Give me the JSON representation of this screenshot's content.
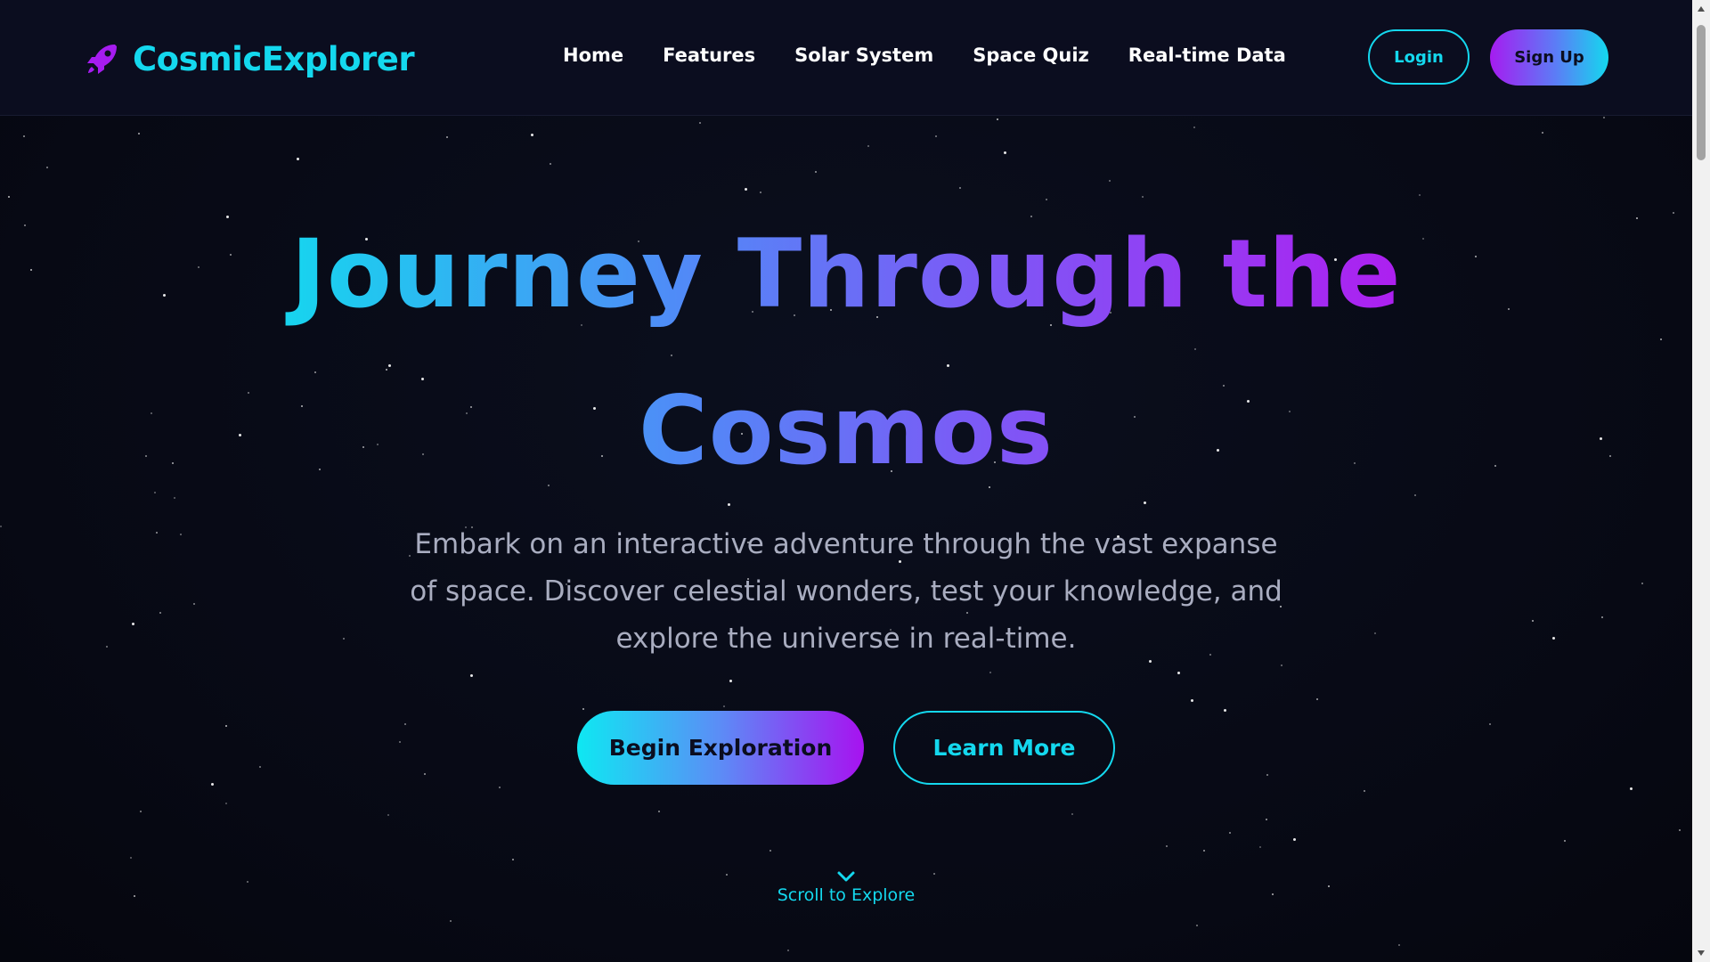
{
  "header": {
    "brand": "CosmicExplorer",
    "nav": [
      {
        "label": "Home"
      },
      {
        "label": "Features"
      },
      {
        "label": "Solar System"
      },
      {
        "label": "Space Quiz"
      },
      {
        "label": "Real-time Data"
      }
    ],
    "login_label": "Login",
    "signup_label": "Sign Up"
  },
  "hero": {
    "title": "Journey Through the Cosmos",
    "subtitle": "Embark on an interactive adventure through the vast expanse of space. Discover celestial wonders, test your knowledge, and explore the universe in real-time.",
    "primary_button": "Begin Exploration",
    "secondary_button": "Learn More",
    "scroll_label": "Scroll to Explore"
  },
  "icons": {
    "logo": "rocket-icon",
    "scroll": "chevron-down-icon"
  },
  "colors": {
    "background": "#070914",
    "header_bg": "#0b0d1f",
    "accent_cyan": "#14d8ee",
    "accent_purple": "#a61cf0",
    "text_muted": "#a9adc0"
  }
}
